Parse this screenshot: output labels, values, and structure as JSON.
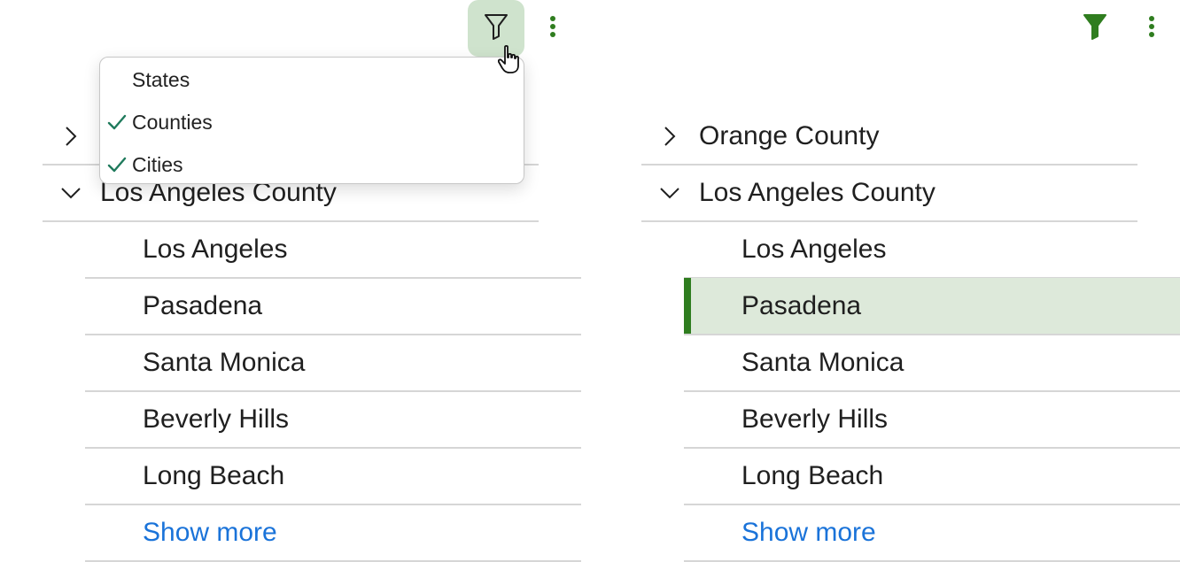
{
  "icons": {
    "filter_outline": "filter-outline-icon",
    "filter_filled": "filter-filled-icon",
    "kebab": "more-vertical-icon",
    "chevron_right": "chevron-right-icon",
    "chevron_down": "chevron-down-icon",
    "check": "check-icon",
    "cursor": "hand-cursor-icon"
  },
  "colors": {
    "accent_green": "#2f7d1f",
    "filter_active_bg": "#cfe3cd",
    "selected_row_bg": "#dde9da",
    "link_blue": "#1a73d9",
    "check_teal": "#1f7a5c",
    "divider": "#d6d6d6"
  },
  "left_panel": {
    "filter_menu": {
      "items": [
        {
          "label": "States",
          "checked": false
        },
        {
          "label": "Counties",
          "checked": true
        },
        {
          "label": "Cities",
          "checked": true
        }
      ]
    },
    "groups": [
      {
        "label": "",
        "expanded": false
      },
      {
        "label": "Los Angeles County",
        "expanded": true
      }
    ],
    "cities": [
      "Los Angeles",
      "Pasadena",
      "Santa Monica",
      "Beverly Hills",
      "Long Beach"
    ],
    "show_more_label": "Show more"
  },
  "right_panel": {
    "groups": [
      {
        "label": "Orange County",
        "expanded": false
      },
      {
        "label": "Los Angeles County",
        "expanded": true
      }
    ],
    "cities": [
      "Los Angeles",
      "Pasadena",
      "Santa Monica",
      "Beverly Hills",
      "Long Beach"
    ],
    "selected_city": "Pasadena",
    "show_more_label": "Show more"
  }
}
